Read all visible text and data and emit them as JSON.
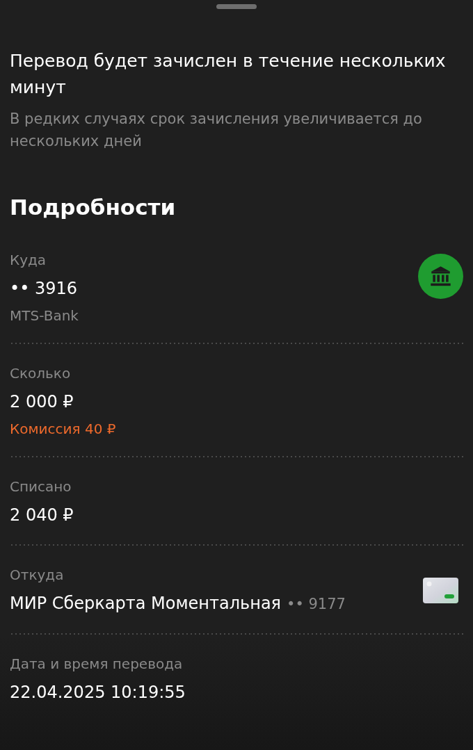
{
  "notice": {
    "title": "Перевод будет зачислен в течение нескольких минут",
    "text": "В редких случаях срок зачисления увеличивается до нескольких дней"
  },
  "details": {
    "title": "Подробности",
    "rows": [
      {
        "kind": "bank",
        "label": "Куда",
        "value": "•• 3916",
        "note": {
          "text": "MTS-Bank",
          "kind": "muted"
        }
      },
      {
        "kind": "text",
        "label": "Сколько",
        "value": "2 000 ₽",
        "note": {
          "text": "Комиссия 40 ₽",
          "kind": "fee"
        }
      },
      {
        "kind": "text",
        "label": "Списано",
        "value": "2 040 ₽"
      },
      {
        "kind": "card",
        "label": "Откуда",
        "value": "МИР Сберкарта Моментальная",
        "value_suffix": "•• 9177"
      },
      {
        "kind": "text",
        "label": "Дата и время перевода",
        "value": "22.04.2025 10:19:55"
      }
    ]
  }
}
